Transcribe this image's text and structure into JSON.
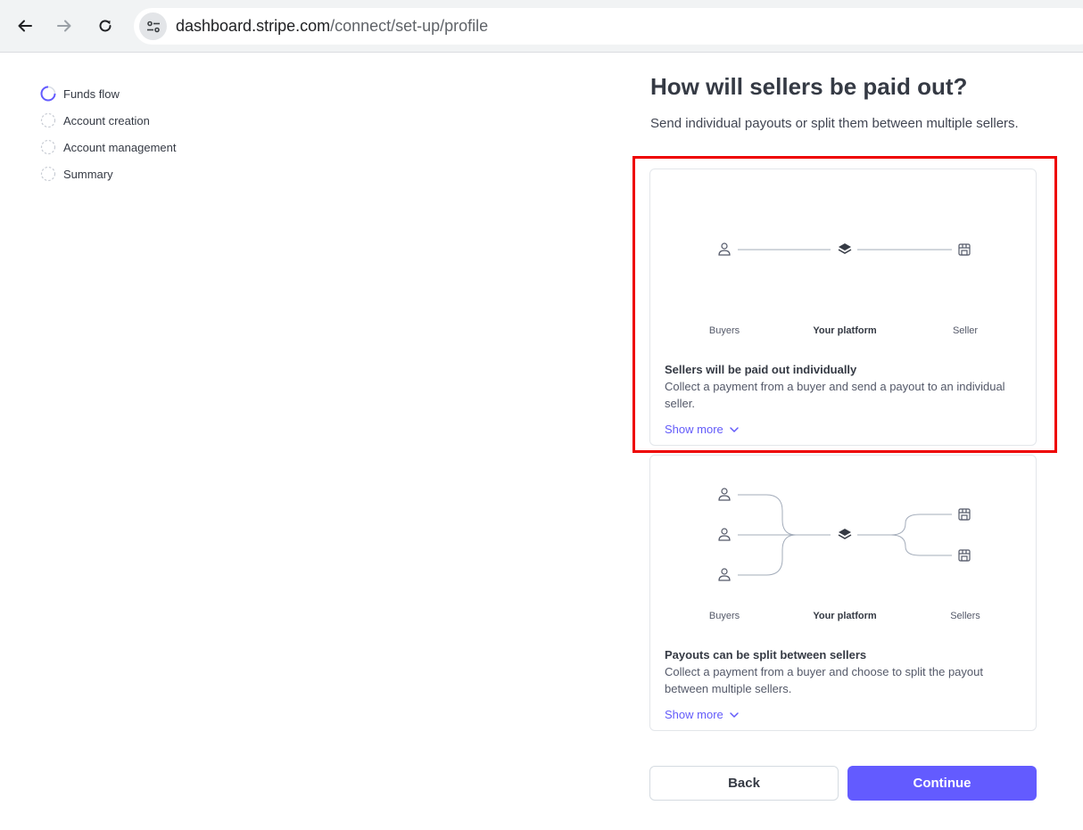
{
  "browser": {
    "url_domain": "dashboard.stripe.com",
    "url_path": "/connect/set-up/profile"
  },
  "stepper": {
    "steps": [
      {
        "label": "Funds flow",
        "state": "in-progress"
      },
      {
        "label": "Account creation",
        "state": "pending"
      },
      {
        "label": "Account management",
        "state": "pending"
      },
      {
        "label": "Summary",
        "state": "pending"
      }
    ]
  },
  "main": {
    "title": "How will sellers be paid out?",
    "subtitle": "Send individual payouts or split them between multiple sellers."
  },
  "options": [
    {
      "diagram_labels": {
        "left": "Buyers",
        "center": "Your platform",
        "right": "Seller"
      },
      "title": "Sellers will be paid out individually",
      "description": "Collect a payment from a buyer and send a payout to an individual seller.",
      "show_more": "Show more",
      "highlighted": true
    },
    {
      "diagram_labels": {
        "left": "Buyers",
        "center": "Your platform",
        "right": "Sellers"
      },
      "title": "Payouts can be split between sellers",
      "description": "Collect a payment from a buyer and choose to split the payout between multiple sellers.",
      "show_more": "Show more",
      "highlighted": false
    }
  ],
  "actions": {
    "back_label": "Back",
    "continue_label": "Continue"
  },
  "colors": {
    "accent": "#635bff",
    "highlight_box": "#ee0000"
  }
}
